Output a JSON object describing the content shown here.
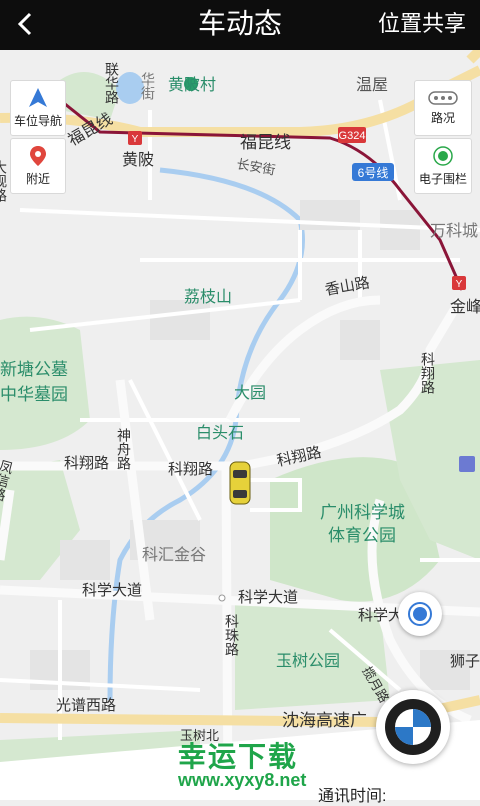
{
  "header": {
    "title": "车动态",
    "share_label": "位置共享"
  },
  "controls": {
    "nav_label": "车位导航",
    "nearby_label": "附近",
    "traffic_label": "路况",
    "fence_label": "电子围栏"
  },
  "map_labels": {
    "huangpi_village": "黄陂村",
    "wenwu": "温屋",
    "fukun_line_top": "福昆线",
    "fukun_line_mid": "福昆线",
    "huangpi": "黄陂",
    "changan_street": "长安街",
    "g324": "G324",
    "line6": "6号线",
    "wanke": "万科城",
    "jinfeng": "金峰",
    "lianxiang_road": "联华路",
    "huajie": "华街",
    "lizhishan": "荔枝山",
    "xiangshan_road": "香山路",
    "xintang": "新塘公墓",
    "zhonghua": "中华墓园",
    "da_yuan": "大园",
    "baitoushi": "白头石",
    "kexiang_road_1": "科翔路",
    "kexiang_road_2": "科翔路",
    "kexiang_road_3": "科翔路",
    "kexiang_road_v": "科翔路",
    "shenzhou_road": "神舟路",
    "fengxin_road": "凤信路",
    "daguan_road": "大观路",
    "stadium_line1": "广州科学城",
    "stadium_line2": "体育公园",
    "kehui": "科汇金谷",
    "kexue_avenue_1": "科学大道",
    "kexue_avenue_2": "科学大道",
    "kexue_avenue_3": "科学大",
    "kezhu_road": "科珠路",
    "yushu_park": "玉树公园",
    "lanyue_road": "揽月路",
    "shizi": "狮子",
    "guangdao_road": "光谱西路",
    "yushubei": "玉树北",
    "shenhai_expressway": "沈海高速广"
  },
  "watermark": {
    "text": "幸运下载",
    "url": "www.xyxy8.net"
  },
  "info": {
    "comm_time_label": "通讯时间:"
  },
  "colors": {
    "header_bg": "#0d0d0d",
    "metro_line": "#8a1538",
    "watermark": "#1fa54a",
    "car": "#e6d13a"
  }
}
